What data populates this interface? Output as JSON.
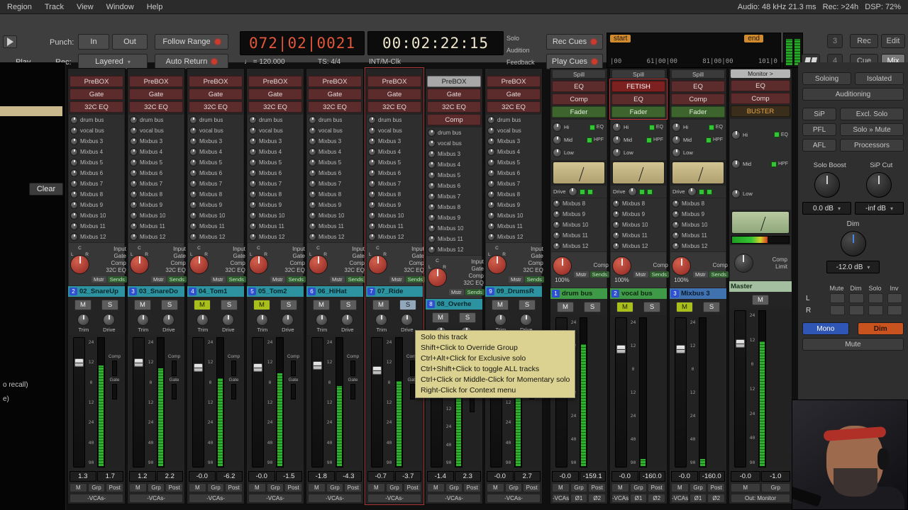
{
  "menubar": {
    "items": [
      "Region",
      "Track",
      "View",
      "Window",
      "Help"
    ],
    "status": "Audio: 48 kHz 21.3 ms   Rec: >24h   DSP: 72%"
  },
  "transport": {
    "punch_label": "Punch:",
    "punch_in": "In",
    "punch_out": "Out",
    "follow_range": "Follow Range",
    "bbt_clock": "072|02|0021",
    "timecode": "00:02:22:15",
    "play_label": "Play",
    "rec_label": "Rec:",
    "rec_mode": "Layered",
    "auto_return": "Auto Return",
    "tempo": "♩ = 120.000",
    "time_sig": "TS: 4/4",
    "sync": "INT/M-Clk",
    "solo": "Solo",
    "audition": "Audition",
    "feedback": "Feedback",
    "rec_cues": "Rec Cues",
    "play_cues": "Play Cues",
    "range_start": "start",
    "range_end": "end",
    "ruler": [
      "|00",
      "61|00|00",
      "81|00|00",
      "101|0"
    ],
    "btn_3": "3",
    "btn_4": "4",
    "rec": "Rec",
    "edit": "Edit",
    "cue": "Cue",
    "mix": "Mix"
  },
  "left_panel": {
    "clear": "Clear",
    "note1": "o recall)",
    "note2": "e)"
  },
  "tooltip": {
    "lines": [
      "Solo this track",
      "Shift+Click to Override Group",
      "Ctrl+Alt+Click for Exclusive solo",
      "Ctrl+Shift+Click to toggle ALL tracks",
      "Ctrl+Click or Middle-Click for Momentary solo",
      "Right-Click for Context menu"
    ]
  },
  "monitor": {
    "soloing": "Soloing",
    "isolated": "Isolated",
    "auditioning": "Auditioning",
    "sip": "SiP",
    "excl_solo": "Excl. Solo",
    "pfl": "PFL",
    "solo_mute": "Solo » Mute",
    "afl": "AFL",
    "processors": "Processors",
    "solo_boost_label": "Solo Boost",
    "sip_cut_label": "SiP Cut",
    "solo_boost_val": "0.0 dB",
    "sip_cut_val": "-inf dB",
    "dim_label": "Dim",
    "dim_val": "-12.0 dB",
    "matrix_cols": [
      "Mute",
      "Dim",
      "Solo",
      "Inv"
    ],
    "matrix_rows": [
      "L",
      "R"
    ],
    "mono": "Mono",
    "dim_button": "Dim",
    "mute": "Mute"
  },
  "shared": {
    "track_sends": [
      "drum bus",
      "vocal bus",
      "Mixbus 3",
      "Mixbus 4",
      "Mixbus 5",
      "Mixbus 6",
      "Mixbus 7",
      "Mixbus 8",
      "Mixbus 9",
      "Mixbus 10",
      "Mixbus 11",
      "Mixbus 12"
    ],
    "bus_sends": [
      "Mixbus 8",
      "Mixbus 9",
      "Mixbus 10",
      "Mixbus 11",
      "Mixbus 12"
    ],
    "track_io": [
      "Input",
      "Gate",
      "Comp",
      "32C EQ"
    ],
    "io_mstr": "Mstr",
    "io_sends": "Sends",
    "pan_marks": [
      "C",
      "L",
      "R"
    ],
    "eq_knobs": [
      "Hi",
      "Mid",
      "Low"
    ],
    "eq_leds": [
      "EQ",
      "HPF"
    ],
    "drive_label": "Drive",
    "trim_label": "Trim",
    "comp_label": "Comp",
    "limit_label": "Limit",
    "fader_scale": [
      "24",
      "12",
      "0",
      "12",
      "24",
      "40",
      "90"
    ],
    "side_labels": [
      "Comp",
      "Gate"
    ],
    "bottom1": [
      "M",
      "Grp",
      "Post"
    ],
    "bottom2_track": [
      "-VCAs-"
    ],
    "bottom2_bus": [
      "-VCAs-",
      "Ø1",
      "Ø2"
    ],
    "ms": {
      "mute": "M",
      "solo": "S"
    }
  },
  "strips": [
    {
      "type": "track",
      "bar": "teal",
      "num": "2",
      "name": "02_SnareUp",
      "procs": [
        {
          "label": "PreBOX",
          "style": "maroon"
        },
        {
          "label": "Gate",
          "style": "maroon"
        },
        {
          "label": "32C EQ",
          "style": "maroon"
        }
      ],
      "gain": "1.3",
      "peak": "1.7",
      "fader": 16,
      "meter": 78
    },
    {
      "type": "track",
      "bar": "teal",
      "num": "3",
      "name": "03_SnareDo",
      "procs": [
        {
          "label": "PreBOX",
          "style": "maroon"
        },
        {
          "label": "Gate",
          "style": "maroon"
        },
        {
          "label": "32C EQ",
          "style": "maroon"
        }
      ],
      "gain": "1.2",
      "peak": "2.2",
      "fader": 16,
      "meter": 76
    },
    {
      "type": "track",
      "bar": "teal",
      "num": "4",
      "name": "04_Tom1",
      "m_on": true,
      "procs": [
        {
          "label": "PreBOX",
          "style": "maroon"
        },
        {
          "label": "Gate",
          "style": "maroon"
        },
        {
          "label": "32C EQ",
          "style": "maroon"
        }
      ],
      "gain": "-0.0",
      "peak": "-6.2",
      "fader": 20,
      "meter": 68
    },
    {
      "type": "track",
      "bar": "teal",
      "num": "5",
      "name": "05_Tom2",
      "m_on": true,
      "procs": [
        {
          "label": "PreBOX",
          "style": "maroon"
        },
        {
          "label": "Gate",
          "style": "maroon"
        },
        {
          "label": "32C EQ",
          "style": "maroon"
        }
      ],
      "gain": "-0.0",
      "peak": "-1.5",
      "fader": 20,
      "meter": 72
    },
    {
      "type": "track",
      "bar": "teal",
      "num": "6",
      "name": "06_HiHat",
      "procs": [
        {
          "label": "PreBOX",
          "style": "maroon"
        },
        {
          "label": "Gate",
          "style": "maroon"
        },
        {
          "label": "32C EQ",
          "style": "maroon"
        }
      ],
      "gain": "-1.8",
      "peak": "-4.3",
      "fader": 18,
      "meter": 62
    },
    {
      "type": "track",
      "bar": "teal",
      "num": "7",
      "name": "07_Ride",
      "selected": true,
      "s_hover": true,
      "procs": [
        {
          "label": "PreBOX",
          "style": "maroon"
        },
        {
          "label": "Gate",
          "style": "maroon"
        },
        {
          "label": "32C EQ",
          "style": "maroon"
        }
      ],
      "gain": "-0.7",
      "peak": "-3.7",
      "fader": 22,
      "meter": 66
    },
    {
      "type": "track",
      "bar": "teal",
      "num": "8",
      "name": "08_Overhe",
      "procs": [
        {
          "label": "PreBOX",
          "style": "light"
        },
        {
          "label": "Gate",
          "style": "maroon"
        },
        {
          "label": "32C EQ",
          "style": "maroon"
        },
        {
          "label": "Comp",
          "style": "maroon"
        }
      ],
      "gain": "-1.4",
      "peak": "2.3",
      "fader": 24,
      "meter": 72
    },
    {
      "type": "track",
      "bar": "teal",
      "num": "9",
      "name": "09_DrumsR",
      "procs": [
        {
          "label": "PreBOX",
          "style": "maroon"
        },
        {
          "label": "Gate",
          "style": "maroon"
        },
        {
          "label": "32C EQ",
          "style": "maroon"
        }
      ],
      "gain": "-0.0",
      "peak": "2.7",
      "fader": 22,
      "meter": 70
    },
    {
      "type": "bus",
      "bar": "green",
      "gap": true,
      "num": "1",
      "name": "drum bus",
      "spill": "Spill",
      "procs": [
        {
          "label": "EQ",
          "style": "maroon"
        },
        {
          "label": "Comp",
          "style": "maroon"
        },
        {
          "label": "Fader",
          "style": "green"
        }
      ],
      "io_pct": "100%",
      "gain": "-0.0",
      "peak": "-159.1",
      "fader": 12,
      "meter": 82
    },
    {
      "type": "bus",
      "bar": "green",
      "num": "2",
      "name": "vocal bus",
      "spill": "Spill",
      "procs_outline": true,
      "m_on": true,
      "procs": [
        {
          "label": "FETISH",
          "style": "fetish"
        },
        {
          "label": "EQ",
          "style": "maroon"
        },
        {
          "label": "Fader",
          "style": "green"
        }
      ],
      "io_pct": "100%",
      "gain": "-0.0",
      "peak": "-160.0",
      "fader": 18,
      "meter": 5
    },
    {
      "type": "bus",
      "bar": "blue",
      "num": "3",
      "name": "Mixbus 3",
      "spill": "Spill",
      "m_on": true,
      "procs": [
        {
          "label": "EQ",
          "style": "maroon"
        },
        {
          "label": "Comp",
          "style": "maroon"
        },
        {
          "label": "Fader",
          "style": "green"
        }
      ],
      "io_pct": "100%",
      "gain": "-0.0",
      "peak": "-160.0",
      "fader": 18,
      "meter": 5
    },
    {
      "type": "master",
      "bar": "pale",
      "name": "Master",
      "header": "Monitor >",
      "procs": [
        {
          "label": "EQ",
          "style": "maroon"
        },
        {
          "label": "Comp",
          "style": "maroon"
        },
        {
          "label": "BUSTER",
          "style": "orange"
        }
      ],
      "hmeter": 62,
      "gain": "-0.0",
      "peak": "-1.0",
      "fader": 18,
      "meter": 80,
      "bottom1": [
        "M",
        "Grp"
      ],
      "bottom2": [
        "Out: Monitor"
      ]
    }
  ]
}
